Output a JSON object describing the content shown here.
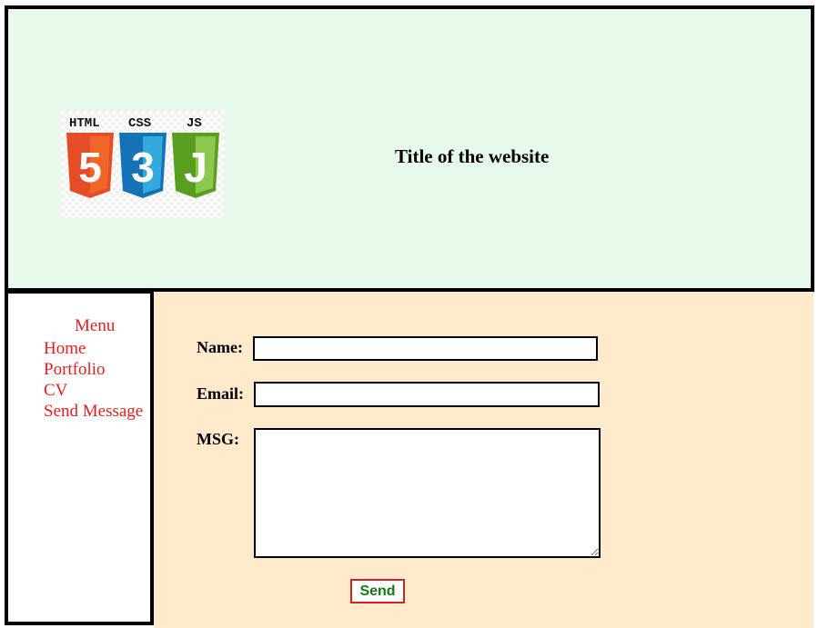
{
  "header": {
    "title": "Title of the website",
    "logo": {
      "icon": "html-css-js-logo",
      "labels": [
        "HTML",
        "CSS",
        "JS"
      ],
      "glyphs": [
        "5",
        "3",
        "J"
      ]
    }
  },
  "sidebar": {
    "title": "Menu",
    "items": [
      {
        "label": "Home"
      },
      {
        "label": "Portfolio"
      },
      {
        "label": "CV"
      },
      {
        "label": "Send Message"
      }
    ]
  },
  "form": {
    "name_label": "Name:",
    "name_value": "",
    "email_label": "Email:",
    "email_value": "",
    "msg_label": "MSG:",
    "msg_value": "",
    "send_label": "Send"
  },
  "colors": {
    "header_bg": "#e6f9ea",
    "main_bg": "#ffebcc",
    "menu_text": "#e02020",
    "send_text": "#127a12",
    "send_border": "#d42020"
  }
}
